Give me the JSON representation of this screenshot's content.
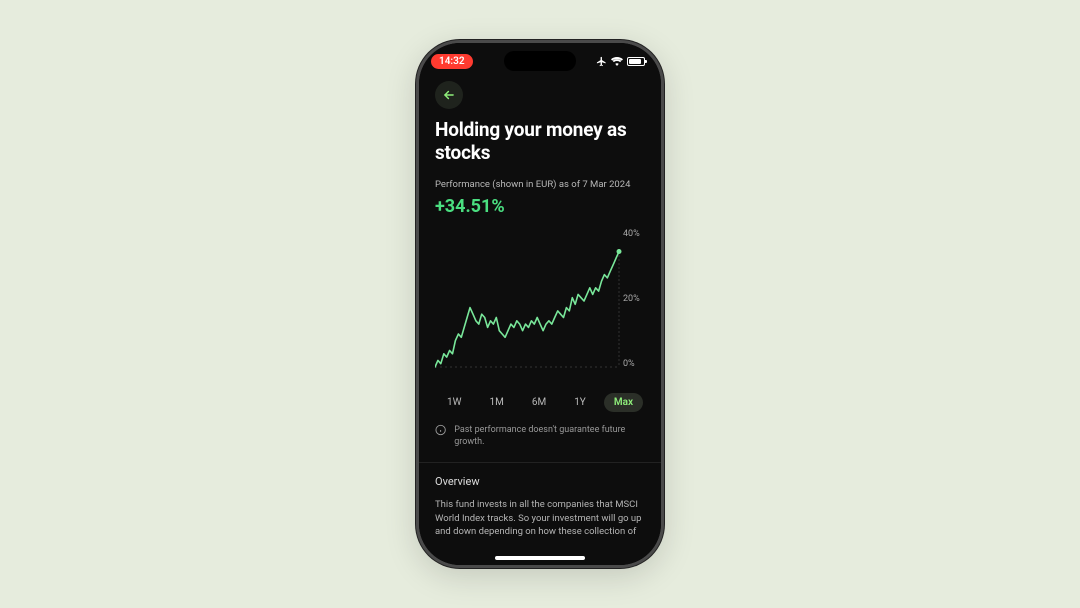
{
  "status_bar": {
    "time": "14:32"
  },
  "back_icon": "arrow-left",
  "page_title": "Holding your money as stocks",
  "performance": {
    "label": "Performance (shown in EUR) as of 7 Mar 2024",
    "value": "+34.51%"
  },
  "chart_data": {
    "type": "line",
    "ylabel": "",
    "ylim": [
      0,
      40
    ],
    "tick_labels": [
      "40%",
      "20%",
      "0%"
    ],
    "x": [
      0,
      1,
      2,
      3,
      4,
      5,
      6,
      7,
      8,
      9,
      10,
      11,
      12,
      13,
      14,
      15,
      16,
      17,
      18,
      19,
      20,
      21,
      22,
      23,
      24,
      25,
      26,
      27,
      28,
      29,
      30,
      31,
      32,
      33,
      34,
      35,
      36,
      37,
      38,
      39,
      40,
      41,
      42,
      43,
      44,
      45,
      46,
      47,
      48,
      49,
      50,
      51,
      52,
      53,
      54,
      55,
      56,
      57,
      58,
      59,
      60,
      61,
      62,
      63
    ],
    "values": [
      0,
      2,
      1,
      4,
      3,
      5,
      4,
      8,
      10,
      9,
      12,
      15,
      18,
      16,
      14,
      13,
      16,
      15,
      12,
      14,
      13,
      15,
      11,
      10,
      9,
      11,
      13,
      12,
      14,
      13,
      11,
      13,
      12,
      14,
      13,
      15,
      13,
      11,
      13,
      14,
      13,
      15,
      17,
      16,
      15,
      18,
      17,
      21,
      19,
      22,
      21,
      20,
      22,
      24,
      22,
      24,
      23,
      26,
      28,
      27,
      29,
      31,
      33,
      35
    ]
  },
  "ranges": {
    "items": [
      {
        "label": "1W"
      },
      {
        "label": "1M"
      },
      {
        "label": "6M"
      },
      {
        "label": "1Y"
      },
      {
        "label": "Max"
      }
    ],
    "active_index": 4
  },
  "disclaimer": "Past performance doesn't guarantee future growth.",
  "overview": {
    "title": "Overview",
    "body": "This fund invests in all the companies that MSCI World Index tracks. So your investment will go up and down depending on how these collection of"
  },
  "colors": {
    "accent": "#4ade80",
    "line": "#79e79a"
  }
}
